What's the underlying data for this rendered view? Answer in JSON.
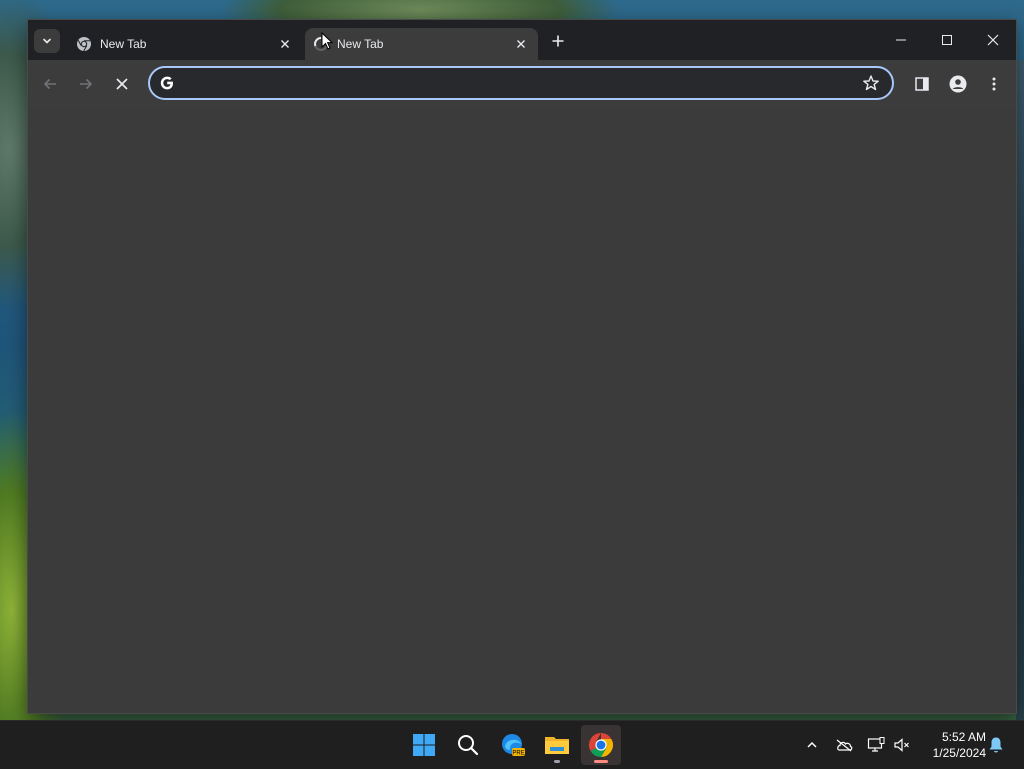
{
  "browser": {
    "tabs": [
      {
        "title": "New Tab",
        "active": false,
        "favicon": "chrome-icon"
      },
      {
        "title": "New Tab",
        "active": true,
        "favicon": "loading-icon"
      }
    ],
    "address_bar": {
      "value": "",
      "placeholder": ""
    },
    "icons": {
      "tab_search": "chevron-down-icon",
      "new_tab": "plus-icon",
      "back": "arrow-left-icon",
      "forward": "arrow-right-icon",
      "stop": "close-icon",
      "bookmark": "star-icon",
      "side_panel": "side-panel-icon",
      "profile": "person-icon",
      "menu": "kebab-menu-icon"
    }
  },
  "taskbar": {
    "apps": [
      "windows-start-icon",
      "search-icon",
      "edge-preview-icon",
      "file-explorer-icon",
      "chrome-icon"
    ],
    "tray": [
      "chevron-up-icon",
      "onedrive-offline-icon",
      "network-icon",
      "volume-muted-icon",
      "notification-bell-icon"
    ],
    "clock": {
      "time": "5:52 AM",
      "date": "1/25/2024"
    }
  },
  "colors": {
    "accent": "#a8c7fa",
    "titlebar": "#202124",
    "toolbar": "#3c3c3c",
    "taskbar": "#1f1f1f"
  }
}
